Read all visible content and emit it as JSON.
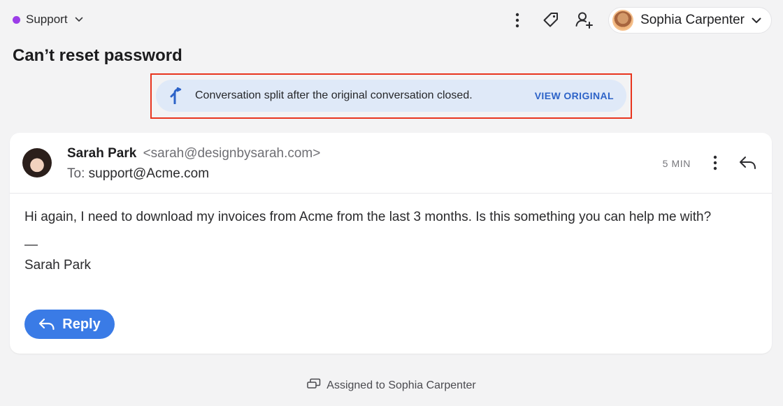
{
  "topbar": {
    "inbox_label": "Support",
    "inbox_color": "#9b3de8",
    "user_name": "Sophia Carpenter",
    "icons": [
      "more-vertical-icon",
      "tag-icon",
      "add-user-icon",
      "chevron-down-icon"
    ]
  },
  "conversation": {
    "title": "Can’t reset password"
  },
  "split_banner": {
    "message": "Conversation split after the original conversation closed.",
    "action_label": "VIEW ORIGINAL",
    "background": "#dfe9f8",
    "action_color": "#2d63c8",
    "highlight_color": "#e8351e"
  },
  "message": {
    "sender_name": "Sarah Park",
    "sender_email": "<sarah@designbysarah.com>",
    "to_label": "To:",
    "to_address": "support@Acme.com",
    "time": "5 MIN",
    "body": "Hi again, I need to download my invoices from Acme from the last 3 months. Is this something you can help me with?",
    "signature_separator": "—",
    "signature_name": "Sarah Park"
  },
  "reply_button": {
    "label": "Reply",
    "color": "#3a7be6"
  },
  "footer": {
    "assigned_text": "Assigned to Sophia Carpenter"
  }
}
